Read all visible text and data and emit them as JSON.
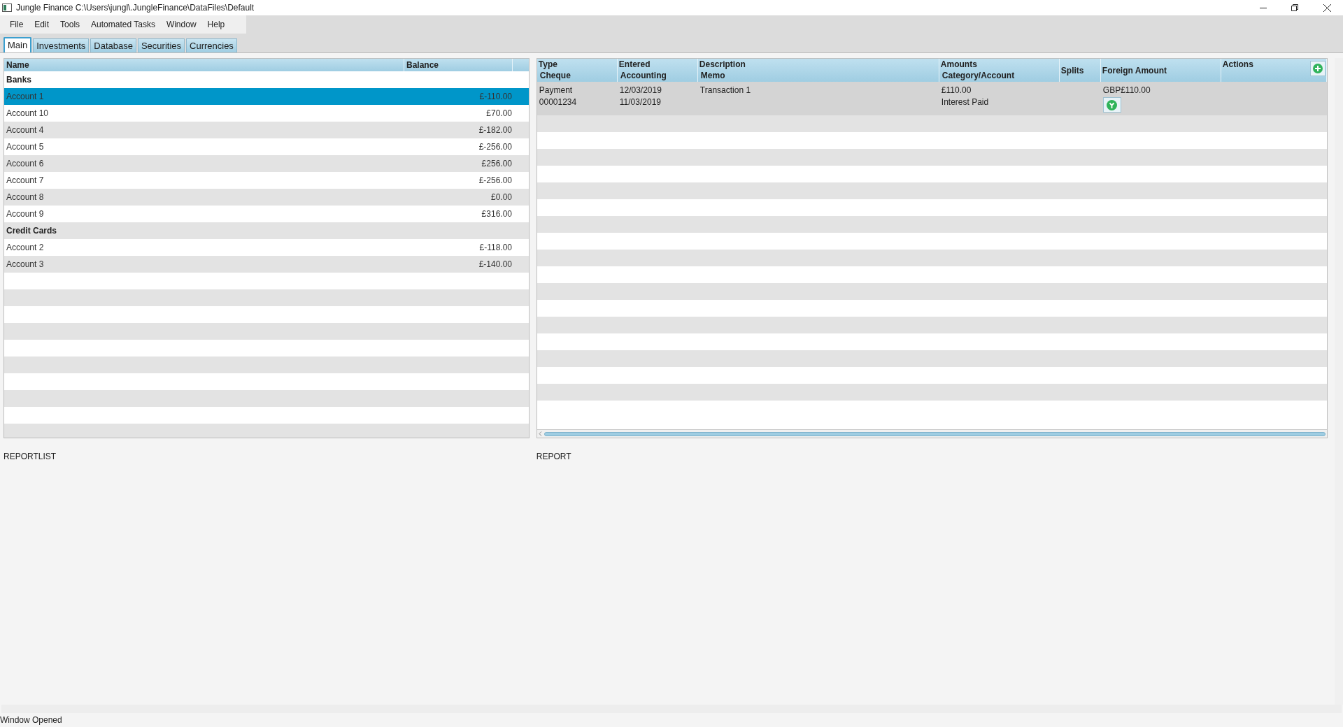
{
  "window": {
    "title": "Jungle Finance C:\\Users\\jungl\\.JungleFinance\\DataFiles\\Default"
  },
  "menu": [
    "File",
    "Edit",
    "Tools",
    "Automated Tasks",
    "Window",
    "Help"
  ],
  "tabs": [
    {
      "label": "Main",
      "selected": true
    },
    {
      "label": "Investments",
      "selected": false
    },
    {
      "label": "Database",
      "selected": false
    },
    {
      "label": "Securities",
      "selected": false
    },
    {
      "label": "Currencies",
      "selected": false
    }
  ],
  "accounts": {
    "columns": [
      "Name",
      "Balance"
    ],
    "rows": [
      {
        "kind": "group",
        "name": "Banks"
      },
      {
        "kind": "account",
        "name": "Account 1",
        "balance": "£-110.00",
        "selected": true
      },
      {
        "kind": "account",
        "name": "Account 10",
        "balance": "£70.00",
        "selected": false
      },
      {
        "kind": "account",
        "name": "Account 4",
        "balance": "£-182.00",
        "selected": false
      },
      {
        "kind": "account",
        "name": "Account 5",
        "balance": "£-256.00",
        "selected": false
      },
      {
        "kind": "account",
        "name": "Account 6",
        "balance": "£256.00",
        "selected": false
      },
      {
        "kind": "account",
        "name": "Account 7",
        "balance": "£-256.00",
        "selected": false
      },
      {
        "kind": "account",
        "name": "Account 8",
        "balance": "£0.00",
        "selected": false
      },
      {
        "kind": "account",
        "name": "Account 9",
        "balance": "£316.00",
        "selected": false
      },
      {
        "kind": "group",
        "name": "Credit Cards"
      },
      {
        "kind": "account",
        "name": "Account 2",
        "balance": "£-118.00",
        "selected": false
      },
      {
        "kind": "account",
        "name": "Account 3",
        "balance": "£-140.00",
        "selected": false
      }
    ]
  },
  "transactions": {
    "columns": [
      [
        "Type",
        "Cheque"
      ],
      [
        "Entered",
        "Accounting"
      ],
      [
        "Description",
        "Memo"
      ],
      [
        "Amounts",
        "Category/Account"
      ],
      [
        "Splits"
      ],
      [
        "Foreign Amount"
      ],
      [
        "Actions"
      ]
    ],
    "rows": [
      {
        "type": "Payment",
        "cheque": "00001234",
        "entered": "12/03/2019",
        "accounting": "11/03/2019",
        "description": "Transaction 1",
        "amount": "£110.00",
        "category": "Interest Paid",
        "foreign_amount": "GBP£110.00"
      }
    ]
  },
  "reports": {
    "left": "REPORTLIST",
    "right": "REPORT"
  },
  "status_bar": "Window Opened"
}
